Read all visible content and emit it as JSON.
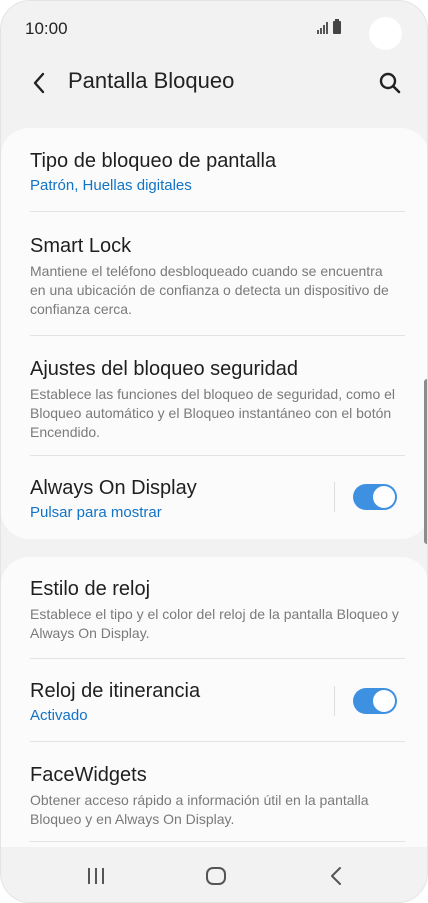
{
  "status_bar": {
    "time": "10:00"
  },
  "app_bar": {
    "title": "Pantalla Bloqueo"
  },
  "section1": {
    "items": [
      {
        "title": "Tipo de bloqueo de pantalla",
        "subtitle": "Patrón, Huellas digitales"
      },
      {
        "title": "Smart Lock",
        "subtitle": "Mantiene el teléfono desbloqueado cuando se encuentra en una ubicación de confianza o detecta un dispositivo de confianza cerca."
      },
      {
        "title": "Ajustes del bloqueo seguridad",
        "subtitle": "Establece las funciones del bloqueo de seguridad, como el Bloqueo automático y el Bloqueo instantáneo con el botón Encendido."
      },
      {
        "title": "Always On Display",
        "subtitle": "Pulsar para mostrar",
        "toggle_on": true
      }
    ]
  },
  "section2": {
    "items": [
      {
        "title": "Estilo de reloj",
        "subtitle": "Establece el tipo y el color del reloj de la pantalla Bloqueo y Always On Display."
      },
      {
        "title": "Reloj de itinerancia",
        "subtitle": "Activado",
        "toggle_on": true
      },
      {
        "title": "FaceWidgets",
        "subtitle": "Obtener acceso rápido a información útil en la pantalla Bloqueo y en Always On Display."
      }
    ]
  },
  "icons": {
    "back": "chevron-left-icon",
    "search": "search-icon",
    "recents": "recents-icon",
    "home": "home-icon",
    "nav_back": "back-icon"
  },
  "colors": {
    "accent": "#1273c6",
    "toggle_on": "#3e91e0",
    "background": "#f2f2f2",
    "card": "#fbfbfb"
  }
}
